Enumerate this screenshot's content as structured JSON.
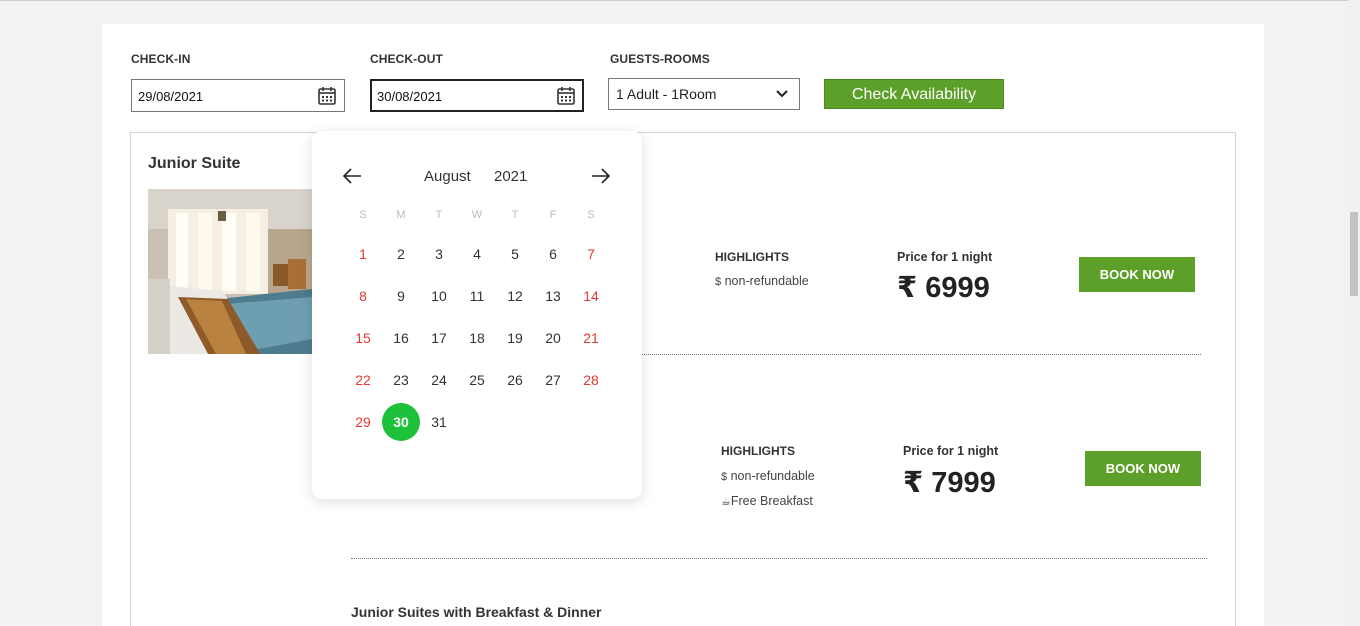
{
  "search": {
    "checkin_label": "CHECK-IN",
    "checkin_value": "29/08/2021",
    "checkout_label": "CHECK-OUT",
    "checkout_value": "30/08/2021",
    "guests_label": "GUESTS-ROOMS",
    "guests_value": "1 Adult - 1Room",
    "check_button": "Check Availability"
  },
  "room": {
    "title": "Junior Suite",
    "image_icon": "room-photo"
  },
  "offers": [
    {
      "highlights_title": "HIGHLIGHTS",
      "highlights": [
        "non-refundable"
      ],
      "price_label": "Price for 1 night",
      "price": "₹ 6999",
      "book_label": "BOOK NOW"
    },
    {
      "highlights_title": "HIGHLIGHTS",
      "highlights": [
        "non-refundable",
        "Free Breakfast"
      ],
      "price_label": "Price for 1 night",
      "price": "₹ 7999",
      "book_label": "BOOK NOW"
    }
  ],
  "next_offer_title": "Junior Suites with Breakfast & Dinner",
  "calendar": {
    "month": "August",
    "year": "2021",
    "weekdays": [
      "S",
      "M",
      "T",
      "W",
      "T",
      "F",
      "S"
    ],
    "weeks": [
      [
        "1",
        "2",
        "3",
        "4",
        "5",
        "6",
        "7"
      ],
      [
        "8",
        "9",
        "10",
        "11",
        "12",
        "13",
        "14"
      ],
      [
        "15",
        "16",
        "17",
        "18",
        "19",
        "20",
        "21"
      ],
      [
        "22",
        "23",
        "24",
        "25",
        "26",
        "27",
        "28"
      ],
      [
        "29",
        "30",
        "31"
      ]
    ],
    "selected_day": "30",
    "prev_icon": "arrow-left-icon",
    "next_icon": "arrow-right-icon"
  },
  "colors": {
    "accent_green": "#5c9f29",
    "selected_day": "#1ec23a",
    "weekend_red": "#e53935"
  }
}
